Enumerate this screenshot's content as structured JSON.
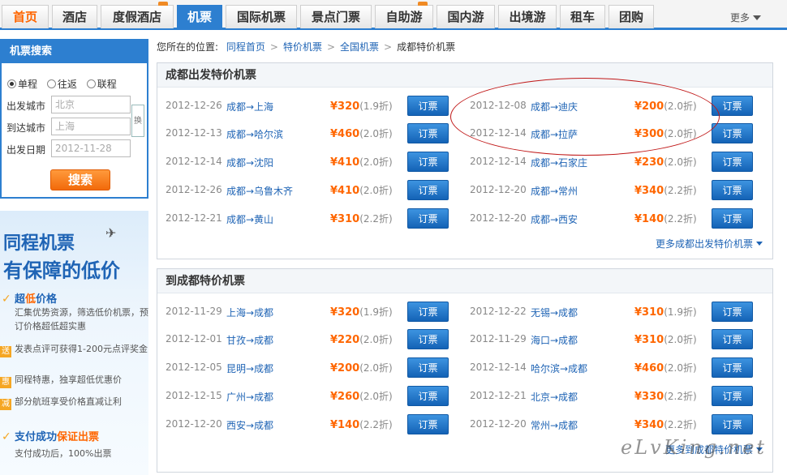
{
  "nav": {
    "tabs": [
      {
        "label": "首页"
      },
      {
        "label": "酒店"
      },
      {
        "label": "度假酒店"
      },
      {
        "label": "机票"
      },
      {
        "label": "国际机票"
      },
      {
        "label": "景点门票"
      },
      {
        "label": "自助游"
      },
      {
        "label": "国内游"
      },
      {
        "label": "出境游"
      },
      {
        "label": "租车"
      },
      {
        "label": "团购"
      }
    ],
    "more": "更多",
    "accent_color": "#2d7fd0",
    "active_tab": "机票"
  },
  "search": {
    "title": "机票搜索",
    "trip_types": [
      "单程",
      "往返",
      "联程"
    ],
    "selected_trip_type": "单程",
    "from_label": "出发城市",
    "from_placeholder": "北京",
    "to_label": "到达城市",
    "to_placeholder": "上海",
    "date_label": "出发日期",
    "date_placeholder": "2012-11-28",
    "swap_label": "换",
    "button": "搜索"
  },
  "promo": {
    "title_line1": "同程机票",
    "title_line2": "有保障的低价",
    "features": [
      {
        "icon": "check-icon",
        "title_pre": "超",
        "title_hl": "低",
        "title_post": "价格",
        "desc": "汇集优势资源，筛选低价机票，预订价格超低超实惠"
      },
      {
        "icon_text": "送",
        "desc": "发表点评可获得1-200元点评奖金"
      },
      {
        "icon_text": "惠",
        "desc": "同程特惠，独享超低优惠价"
      },
      {
        "icon_text": "减",
        "desc": "部分航班享受价格直减让利"
      },
      {
        "icon": "check-icon",
        "title_pre": "支付成功",
        "title_hl": "保证出票",
        "title_post": "",
        "desc": "支付成功后，100%出票"
      }
    ]
  },
  "breadcrumb": {
    "prefix": "您所在的位置:",
    "items": [
      "同程首页",
      "特价机票",
      "全国机票",
      "成都特价机票"
    ]
  },
  "section_depart": {
    "title": "成都出发特价机票",
    "more": "更多成都出发特价机票",
    "rows": [
      {
        "date": "2012-12-26",
        "route": "成都→上海",
        "price": "¥320",
        "discount": "(1.9折)",
        "book": "订票"
      },
      {
        "date": "2012-12-08",
        "route": "成都→迪庆",
        "price": "¥200",
        "discount": "(2.0折)",
        "book": "订票"
      },
      {
        "date": "2012-12-13",
        "route": "成都→哈尔滨",
        "price": "¥460",
        "discount": "(2.0折)",
        "book": "订票"
      },
      {
        "date": "2012-12-14",
        "route": "成都→拉萨",
        "price": "¥300",
        "discount": "(2.0折)",
        "book": "订票"
      },
      {
        "date": "2012-12-14",
        "route": "成都→沈阳",
        "price": "¥410",
        "discount": "(2.0折)",
        "book": "订票"
      },
      {
        "date": "2012-12-14",
        "route": "成都→石家庄",
        "price": "¥230",
        "discount": "(2.0折)",
        "book": "订票"
      },
      {
        "date": "2012-12-26",
        "route": "成都→乌鲁木齐",
        "price": "¥410",
        "discount": "(2.0折)",
        "book": "订票"
      },
      {
        "date": "2012-12-20",
        "route": "成都→常州",
        "price": "¥340",
        "discount": "(2.2折)",
        "book": "订票"
      },
      {
        "date": "2012-12-21",
        "route": "成都→黄山",
        "price": "¥310",
        "discount": "(2.2折)",
        "book": "订票"
      },
      {
        "date": "2012-12-20",
        "route": "成都→西安",
        "price": "¥140",
        "discount": "(2.2折)",
        "book": "订票"
      }
    ]
  },
  "section_arrive": {
    "title": "到成都特价机票",
    "more": "更多到成都特价机票",
    "rows": [
      {
        "date": "2012-11-29",
        "route": "上海→成都",
        "price": "¥320",
        "discount": "(1.9折)",
        "book": "订票"
      },
      {
        "date": "2012-12-22",
        "route": "无锡→成都",
        "price": "¥310",
        "discount": "(1.9折)",
        "book": "订票"
      },
      {
        "date": "2012-12-01",
        "route": "甘孜→成都",
        "price": "¥220",
        "discount": "(2.0折)",
        "book": "订票"
      },
      {
        "date": "2012-11-29",
        "route": "海口→成都",
        "price": "¥310",
        "discount": "(2.0折)",
        "book": "订票"
      },
      {
        "date": "2012-12-05",
        "route": "昆明→成都",
        "price": "¥200",
        "discount": "(2.0折)",
        "book": "订票"
      },
      {
        "date": "2012-12-14",
        "route": "哈尔滨→成都",
        "price": "¥460",
        "discount": "(2.0折)",
        "book": "订票"
      },
      {
        "date": "2012-12-15",
        "route": "广州→成都",
        "price": "¥260",
        "discount": "(2.0折)",
        "book": "订票"
      },
      {
        "date": "2012-12-21",
        "route": "北京→成都",
        "price": "¥330",
        "discount": "(2.2折)",
        "book": "订票"
      },
      {
        "date": "2012-12-20",
        "route": "西安→成都",
        "price": "¥140",
        "discount": "(2.2折)",
        "book": "订票"
      },
      {
        "date": "2012-12-20",
        "route": "常州→成都",
        "price": "¥340",
        "discount": "(2.2折)",
        "book": "订票"
      }
    ]
  },
  "watermark": "eLvKing.net",
  "colors": {
    "price": "#ff6600",
    "link": "#1f64b5",
    "annotation_ellipse": "#c01818"
  }
}
